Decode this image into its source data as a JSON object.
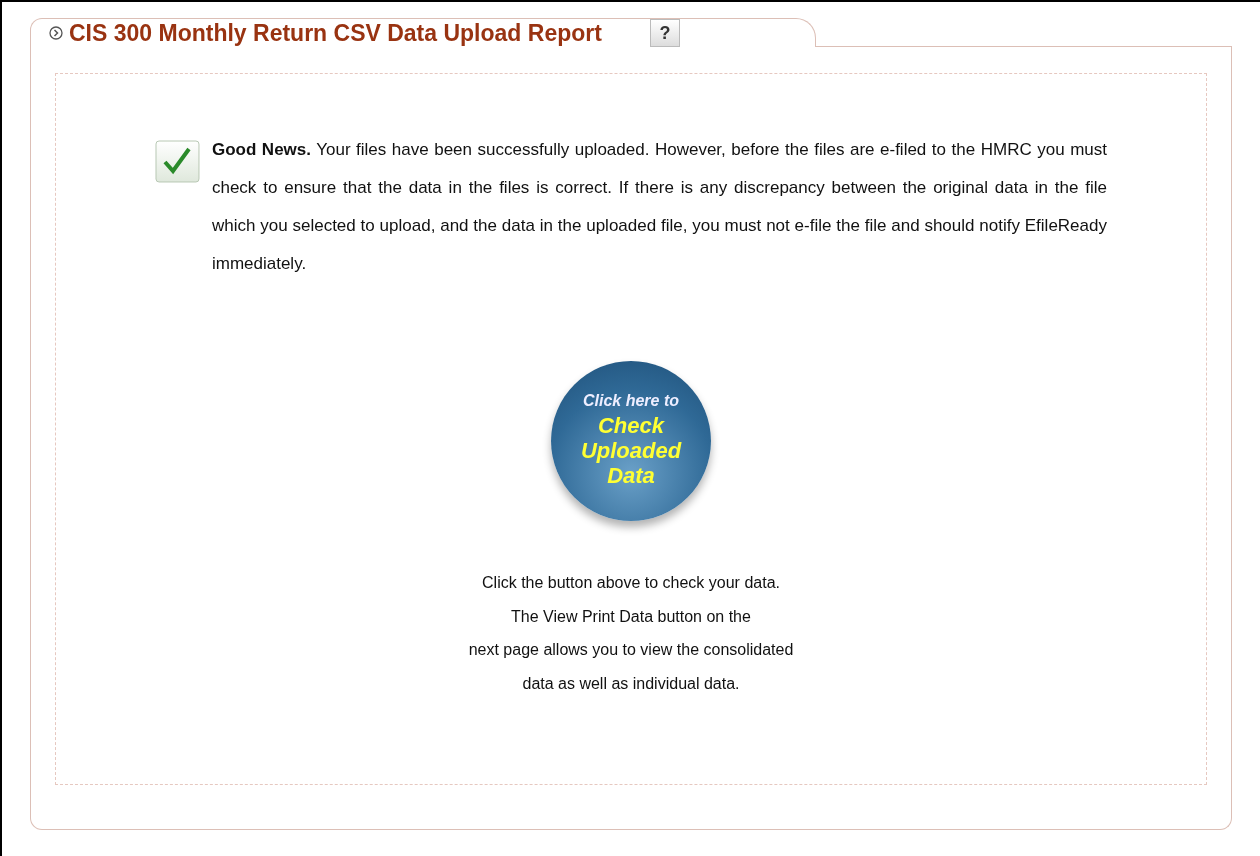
{
  "panel": {
    "title": "CIS 300 Monthly Return CSV Data Upload Report",
    "help_button": "?"
  },
  "notice": {
    "text": "**Good News.** Your files have been successfully uploaded. However, before the files are e-filed to the HMRC you must check to ensure that the data in the files is correct. If there is any discrepancy between the original data in the file which you selected to upload, and the data in the uploaded file, you must not e-file the file and should notify EfileReady immediately."
  },
  "check_button": {
    "caption": "Click here to",
    "label": "Check Uploaded Data"
  },
  "instructions": [
    "Click the button above to check your data.",
    "The View Print Data button on the",
    "next page allows you to view the consolidated",
    "data as well as individual data."
  ]
}
